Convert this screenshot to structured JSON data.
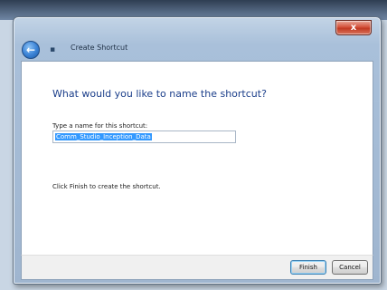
{
  "window": {
    "title": "Create Shortcut",
    "close_glyph": "x"
  },
  "wizard": {
    "back_glyph": "←",
    "icon_glyph": "▪"
  },
  "content": {
    "heading": "What would you like to name the shortcut?",
    "field_label": "Type a name for this shortcut:",
    "input_value": "Comm_Studio_Inception_Data",
    "hint": "Click Finish to create the shortcut."
  },
  "footer": {
    "finish_label": "Finish",
    "cancel_label": "Cancel"
  },
  "colors": {
    "heading_blue": "#1b3e8a",
    "selection": "#3399ff",
    "close_red": "#c23a22"
  },
  "icons": [
    "back-arrow-icon",
    "shortcut-wizard-icon",
    "close-icon"
  ]
}
